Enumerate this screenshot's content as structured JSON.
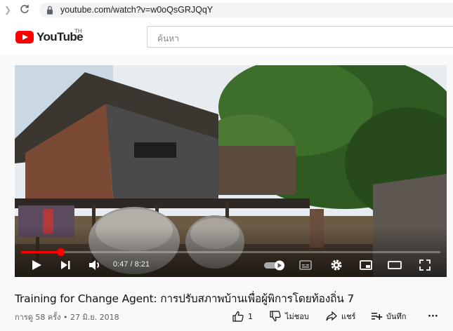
{
  "browser": {
    "url": "youtube.com/watch?v=w0oQsGRJQqY"
  },
  "header": {
    "logo_text": "YouTube",
    "country_code": "TH",
    "search_placeholder": "ค้นหา"
  },
  "player": {
    "current_time": "0:47",
    "duration": "8:21",
    "time_display": "0:47 / 8:21",
    "progress_fraction": 0.094,
    "icons": [
      "play-icon",
      "next-icon",
      "volume-icon",
      "autoplay-toggle-icon",
      "subtitles-icon",
      "settings-icon",
      "miniplayer-icon",
      "theater-mode-icon",
      "fullscreen-icon"
    ]
  },
  "video": {
    "title": "Training for Change Agent: การปรับสภาพบ้านเพื่อผู้พิการโดยท้องถิ่น 7",
    "meta": "การดู 58 ครั้ง • 27 มิ.ย. 2018",
    "actions": {
      "like_count": "1",
      "dislike_label": "ไม่ชอบ",
      "share_label": "แชร์",
      "save_label": "บันทึก",
      "more_label": "···"
    }
  },
  "colors": {
    "brand_red": "#ff0000",
    "text_primary": "#0f0f0f",
    "text_secondary": "#606060"
  }
}
